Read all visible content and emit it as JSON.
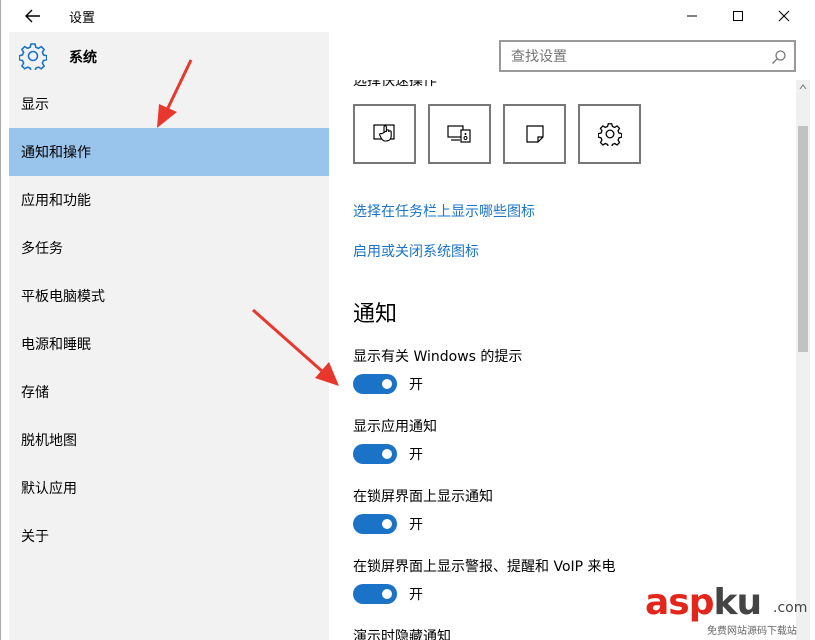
{
  "window": {
    "title": "设置",
    "back_icon": "back-arrow-icon",
    "minimize_icon": "minimize-icon",
    "maximize_icon": "maximize-icon",
    "close_icon": "close-icon"
  },
  "sidebar": {
    "header_icon": "gear-icon",
    "header_title": "系统",
    "items": [
      {
        "label": "显示",
        "active": false
      },
      {
        "label": "通知和操作",
        "active": true
      },
      {
        "label": "应用和功能",
        "active": false
      },
      {
        "label": "多任务",
        "active": false
      },
      {
        "label": "平板电脑模式",
        "active": false
      },
      {
        "label": "电源和睡眠",
        "active": false
      },
      {
        "label": "存储",
        "active": false
      },
      {
        "label": "脱机地图",
        "active": false
      },
      {
        "label": "默认应用",
        "active": false
      },
      {
        "label": "关于",
        "active": false
      }
    ]
  },
  "search": {
    "placeholder": "查找设置",
    "icon": "search-icon"
  },
  "content": {
    "cut_heading": "选择快速操作",
    "quick_actions": [
      {
        "icon": "tablet-mode-icon"
      },
      {
        "icon": "project-icon"
      },
      {
        "icon": "note-icon"
      },
      {
        "icon": "settings-gear-icon"
      }
    ],
    "links": {
      "taskbar_icons": "选择在任务栏上显示哪些图标",
      "system_icons": "启用或关闭系统图标"
    },
    "notifications_title": "通知",
    "settings": [
      {
        "label": "显示有关 Windows 的提示",
        "state": "开",
        "on": true
      },
      {
        "label": "显示应用通知",
        "state": "开",
        "on": true
      },
      {
        "label": "在锁屏界面上显示通知",
        "state": "开",
        "on": true
      },
      {
        "label": "在锁屏界面上显示警报、提醒和 VoIP 来电",
        "state": "开",
        "on": true
      }
    ],
    "cut_bottom_label": "演示时隐藏通知"
  },
  "colors": {
    "accent": "#1a73c7",
    "active_nav": "#99c4ec",
    "sidebar_bg": "#f2f2f2",
    "annotation_arrow": "#e8372c"
  },
  "watermark": {
    "brand_asp": "asp",
    "brand_ku": "ku",
    "domain": ".com",
    "tagline": "免费网站源码下载站"
  }
}
